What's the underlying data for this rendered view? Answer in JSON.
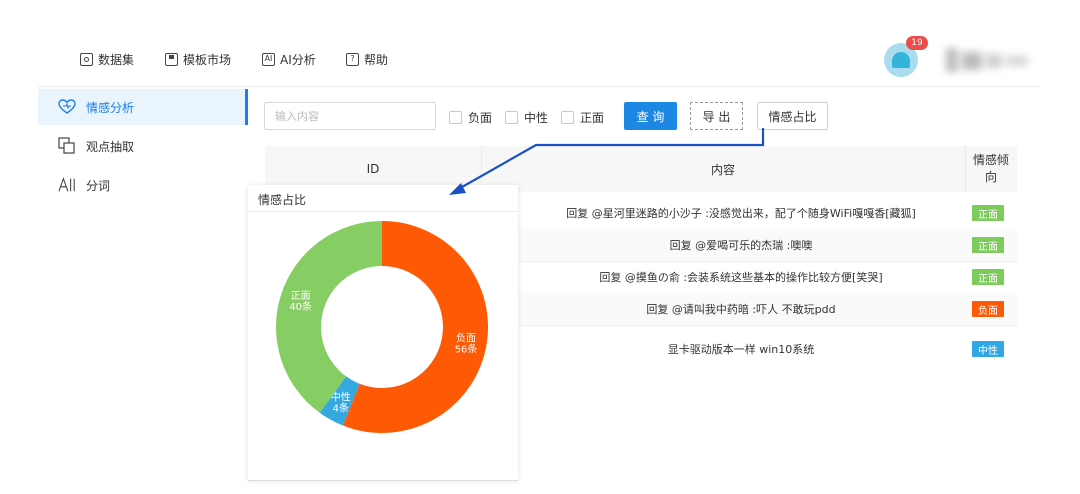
{
  "nav": {
    "items": [
      {
        "label": "数据集",
        "icon": "dataset-icon"
      },
      {
        "label": "模板市场",
        "icon": "template-icon"
      },
      {
        "label": "AI分析",
        "icon": "ai-icon",
        "icon_text": "AI"
      },
      {
        "label": "帮助",
        "icon": "help-icon",
        "icon_text": "?"
      }
    ],
    "notification_count": "19"
  },
  "sidebar": {
    "items": [
      {
        "label": "情感分析",
        "icon": "heart-icon",
        "active": true
      },
      {
        "label": "观点抽取",
        "icon": "extract-icon",
        "active": false
      },
      {
        "label": "分词",
        "icon": "segment-icon",
        "active": false
      }
    ]
  },
  "toolbar": {
    "search_placeholder": "输入内容",
    "search_value": "",
    "filters": [
      {
        "label": "负面",
        "checked": false
      },
      {
        "label": "中性",
        "checked": false
      },
      {
        "label": "正面",
        "checked": false
      }
    ],
    "query_label": "查 询",
    "export_label": "导 出",
    "ratio_label": "情感占比"
  },
  "table": {
    "headers": {
      "id": "ID",
      "content": "内容",
      "sentiment_line1": "情感倾",
      "sentiment_line2": "向"
    },
    "rows": [
      {
        "content": "回复 @星河里迷路的小沙子 :没感觉出来，配了个随身WiFi嘎嘎香[藏狐]",
        "sentiment": "正面"
      },
      {
        "content": "回复 @爱喝可乐的杰瑞 :噢噢",
        "sentiment": "正面"
      },
      {
        "content": "回复 @摸鱼の俞 :会装系统这些基本的操作比较方便[笑哭]",
        "sentiment": "正面"
      },
      {
        "content": "回复 @请叫我中药暗 :吓人 不敢玩pdd",
        "sentiment": "负面"
      },
      {
        "content": "显卡驱动版本一样 win10系统",
        "sentiment": "中性"
      }
    ]
  },
  "popup": {
    "title": "情感占比"
  },
  "chart_data": {
    "type": "pie",
    "donut": true,
    "title": "情感占比",
    "categories": [
      "负面",
      "中性",
      "正面"
    ],
    "values": [
      56,
      4,
      40
    ],
    "labels": [
      "负面\n56条",
      "中性\n4条",
      "正面\n40条"
    ],
    "colors": [
      "#fe5a05",
      "#35a8e0",
      "#86ce63"
    ]
  },
  "colors": {
    "accent": "#1d87e4",
    "positive": "#7dcb5b",
    "negative": "#fe5a05",
    "neutral": "#2ea9e6"
  }
}
